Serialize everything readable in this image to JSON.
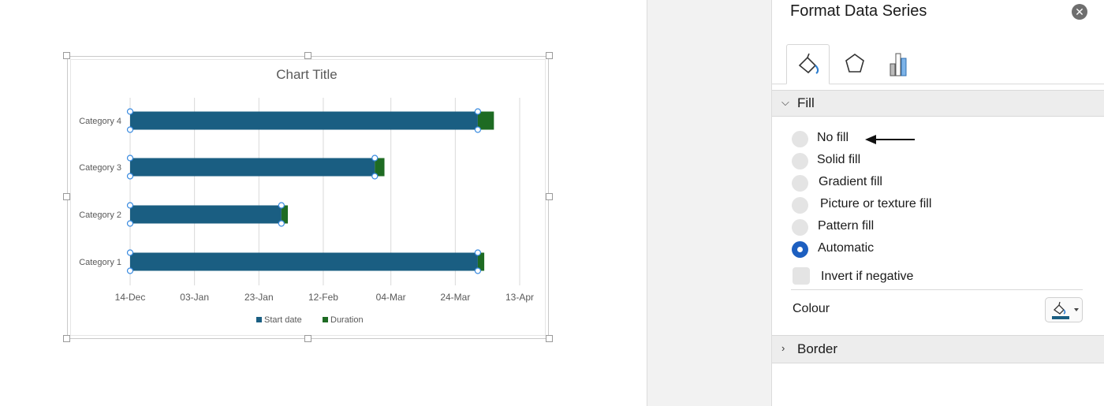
{
  "chart_data": {
    "type": "bar",
    "orientation": "horizontal",
    "stacked": true,
    "title": "Chart Title",
    "categories": [
      "Category 4",
      "Category 3",
      "Category 2",
      "Category 1"
    ],
    "x_tick_labels": [
      "14-Dec",
      "03-Jan",
      "23-Jan",
      "12-Feb",
      "04-Mar",
      "24-Mar",
      "13-Apr"
    ],
    "xlim": [
      "14-Dec",
      "13-Apr"
    ],
    "series": [
      {
        "name": "Start date",
        "color": "#1a5e82",
        "values": [
          "31-Mar",
          "28-Feb",
          "30-Jan",
          "31-Mar"
        ]
      },
      {
        "name": "Duration",
        "color": "#1e6b23",
        "values": [
          5,
          3,
          2,
          2
        ]
      }
    ],
    "grid": true,
    "legend_position": "bottom",
    "selected_series": "Start date"
  },
  "panel": {
    "title": "Format Data Series",
    "close_icon": "close-icon",
    "tabs": [
      {
        "icon": "fill-line-icon",
        "active": true
      },
      {
        "icon": "effects-pentagon-icon",
        "active": false
      },
      {
        "icon": "series-options-icon",
        "active": false
      }
    ],
    "fill_section": {
      "label": "Fill",
      "expanded": true,
      "options": [
        {
          "label": "No fill",
          "selected": false
        },
        {
          "label": "Solid fill",
          "selected": false
        },
        {
          "label": "Gradient fill",
          "selected": false
        },
        {
          "label": "Picture or texture fill",
          "selected": false
        },
        {
          "label": "Pattern fill",
          "selected": false
        },
        {
          "label": "Automatic",
          "selected": true
        }
      ],
      "invert_label": "Invert if negative",
      "colour_label": "Colour",
      "colour_value": "#1a5e82"
    },
    "border_section": {
      "label": "Border",
      "expanded": false
    }
  },
  "accent_color": "#1d5fc0"
}
